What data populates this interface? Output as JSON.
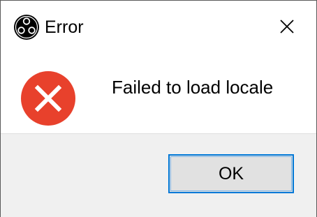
{
  "window": {
    "title": "Error",
    "app_icon": "obs-logo-icon",
    "close_icon": "close-icon"
  },
  "content": {
    "icon": "error-icon",
    "message": "Failed to load locale"
  },
  "buttons": {
    "ok_label": "OK"
  },
  "colors": {
    "error_red": "#e8412c",
    "focus_blue": "#0078d7",
    "footer_bg": "#f0f0f0",
    "button_bg": "#e1e1e1"
  }
}
